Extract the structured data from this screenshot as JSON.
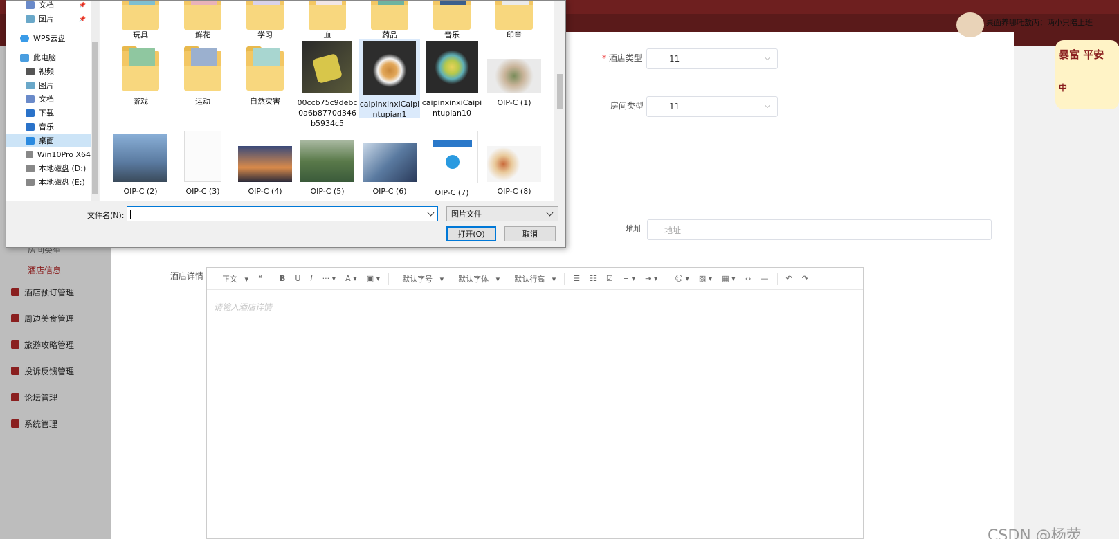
{
  "dialog": {
    "nav_items": [
      {
        "label": "文档",
        "icon": "document-icon"
      },
      {
        "label": "图片",
        "icon": "picture-icon"
      },
      {
        "label": "WPS云盘",
        "icon": "cloud-icon"
      },
      {
        "label": "此电脑",
        "icon": "computer-icon"
      },
      {
        "label": "视频",
        "icon": "video-icon"
      },
      {
        "label": "图片",
        "icon": "picture-icon"
      },
      {
        "label": "文档",
        "icon": "document-icon"
      },
      {
        "label": "下载",
        "icon": "download-icon"
      },
      {
        "label": "音乐",
        "icon": "music-icon"
      },
      {
        "label": "桌面",
        "icon": "desktop-icon"
      },
      {
        "label": "Win10Pro X64",
        "icon": "drive-icon"
      },
      {
        "label": "本地磁盘 (D:)",
        "icon": "drive-icon"
      },
      {
        "label": "本地磁盘 (E:)",
        "icon": "drive-icon"
      }
    ],
    "files": [
      {
        "label": "玩具"
      },
      {
        "label": "鲜花"
      },
      {
        "label": "学习"
      },
      {
        "label": "血"
      },
      {
        "label": "药品"
      },
      {
        "label": "音乐"
      },
      {
        "label": "印章"
      },
      {
        "label": "游戏"
      },
      {
        "label": "运动"
      },
      {
        "label": "自然灾害"
      },
      {
        "label": "00ccb75c9debc0a6b8770d346b5934c5"
      },
      {
        "label": "caipinxinxiCaipintupian1"
      },
      {
        "label": "caipinxinxiCaipintupian10"
      },
      {
        "label": "OIP-C (1)"
      },
      {
        "label": "OIP-C (2)"
      },
      {
        "label": "OIP-C (3)"
      },
      {
        "label": "OIP-C (4)"
      },
      {
        "label": "OIP-C (5)"
      },
      {
        "label": "OIP-C (6)"
      },
      {
        "label": "OIP-C (7)"
      },
      {
        "label": "OIP-C (8)"
      }
    ],
    "filename_label": "文件名(N):",
    "filename_value": "",
    "filetype_value": "图片文件",
    "open_label": "打开(O)",
    "cancel_label": "取消",
    "accent": "#0078d7"
  },
  "sidebar": {
    "sub_items": [
      {
        "label": "房间类型"
      },
      {
        "label": "酒店信息"
      }
    ],
    "items": [
      {
        "label": "酒店预订管理"
      },
      {
        "label": "周边美食管理"
      },
      {
        "label": "旅游攻略管理"
      },
      {
        "label": "投诉反馈管理"
      },
      {
        "label": "论坛管理"
      },
      {
        "label": "系统管理"
      }
    ],
    "active_color": "#8a1f1f"
  },
  "form": {
    "hotel_type_label": "酒店类型",
    "hotel_type_required": "*",
    "hotel_type_value": "11",
    "room_type_label": "房间类型",
    "room_type_value": "11",
    "address_label": "地址",
    "address_placeholder": "地址",
    "detail_label": "酒店详情",
    "editor_placeholder": "请输入酒店详情",
    "toolbar": {
      "paragraph": "正文",
      "font_size": "默认字号",
      "font_family": "默认字体",
      "line_height": "默认行高"
    }
  },
  "header": {
    "banner_text": "桌面养哪吒敖丙：两小只陪上班",
    "deco_text": "暴富 平安",
    "deco_small": "中"
  },
  "watermark": "CSDN @杨荧"
}
